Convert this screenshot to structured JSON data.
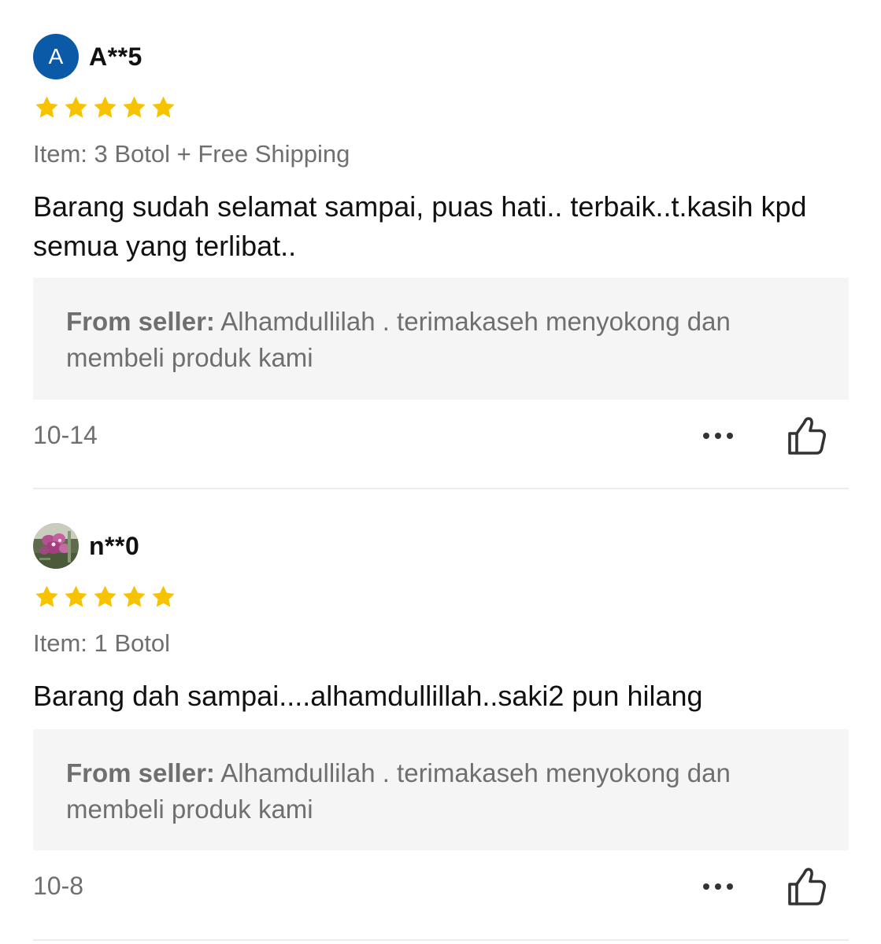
{
  "reviews": [
    {
      "avatar_letter": "A",
      "avatar_color": "#0b5aa8",
      "username": "A**5",
      "rating": 5,
      "item": "Item: 3 Botol + Free Shipping",
      "text": "Barang sudah selamat sampai, puas hati.. terbaik..t.kasih kpd semua yang terlibat..",
      "seller_label": "From seller:",
      "seller_reply": "Alhamdullilah . terimakaseh menyokong dan membeli produk kami",
      "date": "10-14",
      "more_icon": "more-dots-icon",
      "like_icon": "thumbs-up-icon"
    },
    {
      "avatar_image": "flower-photo",
      "username": "n**0",
      "rating": 5,
      "item": "Item: 1 Botol",
      "text": "Barang dah sampai....alhamdullillah..saki2 pun hilang",
      "seller_label": "From seller:",
      "seller_reply": "Alhamdullilah . terimakaseh menyokong dan membeli produk kami",
      "date": "10-8",
      "more_icon": "more-dots-icon",
      "like_icon": "thumbs-up-icon"
    }
  ],
  "colors": {
    "star": "#f7c300",
    "muted_text": "#6f6f6f",
    "seller_box_bg": "#f5f5f5"
  }
}
